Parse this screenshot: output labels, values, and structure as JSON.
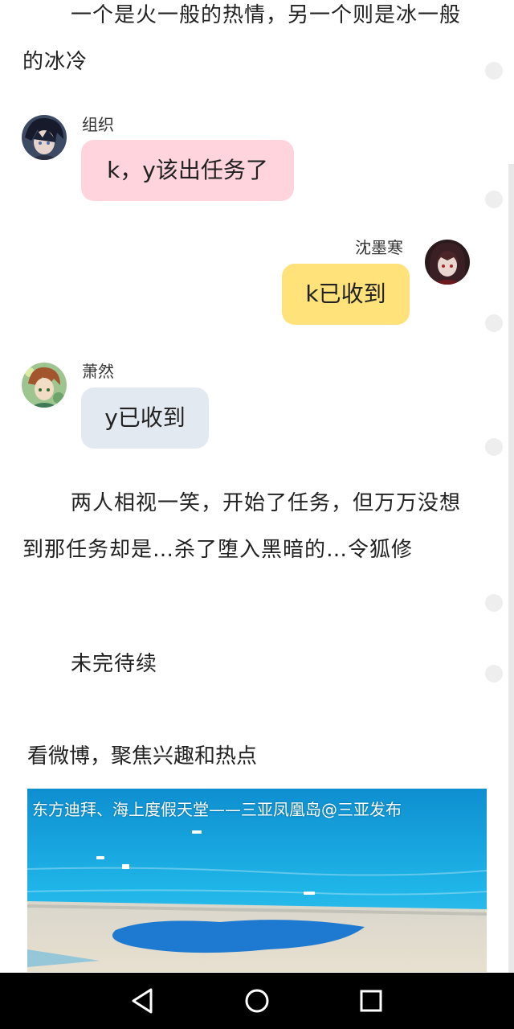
{
  "story": {
    "intro": "一个是火一般的热情，另一个则是冰一般的冰冷",
    "closing": "两人相视一笑，开始了任务，但万万没想到那任务却是…杀了堕入黑暗的…令狐修",
    "tbc": "未完待续"
  },
  "chat": [
    {
      "name": "组织",
      "text": "k，y该出任务了",
      "color": "#ffd4dc"
    },
    {
      "name": "沈墨寒",
      "text": "k已收到",
      "color": "#ffe27a"
    },
    {
      "name": "萧然",
      "text": "y已收到",
      "color": "#e3e9f1"
    }
  ],
  "ad": {
    "title": "看微博，聚焦兴趣和热点",
    "caption": "东方迪拜、海上度假天堂——三亚凤凰岛@三亚发布"
  },
  "icons": {
    "avatar_zuzhi": "avatar-dark-hair",
    "avatar_shen": "avatar-dark-red",
    "avatar_xiao": "avatar-warm-green",
    "nav": [
      "back-triangle-icon",
      "home-circle-icon",
      "recent-square-icon"
    ]
  }
}
